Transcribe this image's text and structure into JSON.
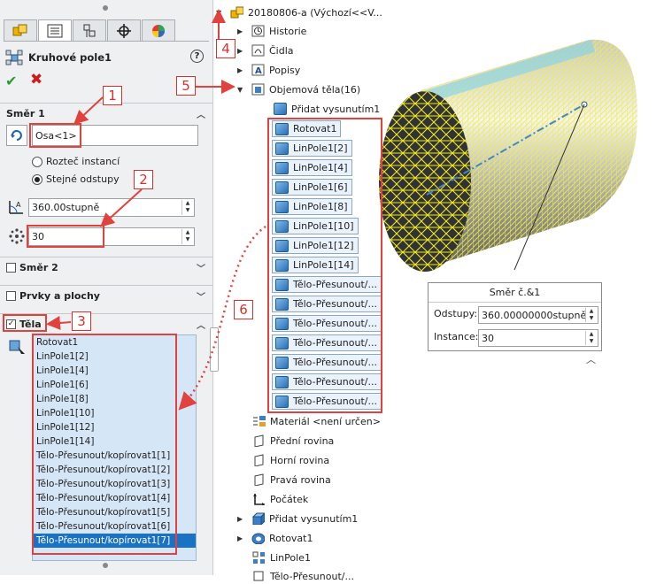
{
  "pm": {
    "title": "Kruhové pole1",
    "help": "?",
    "dir1": {
      "header": "Směr 1",
      "axis_value": "Osa<1>",
      "radio_spacing": "Rozteč instancí",
      "radio_equal": "Stejné odstupy",
      "angle_value": "360.00stupně",
      "count_value": "30"
    },
    "dir2_label": "Směr 2",
    "features_label": "Prvky a plochy",
    "bodies_label": "Těla",
    "bodies": [
      "Rotovat1",
      "LinPole1[2]",
      "LinPole1[4]",
      "LinPole1[6]",
      "LinPole1[8]",
      "LinPole1[10]",
      "LinPole1[12]",
      "LinPole1[14]",
      "Tělo-Přesunout/kopírovat1[1]",
      "Tělo-Přesunout/kopírovat1[2]",
      "Tělo-Přesunout/kopírovat1[3]",
      "Tělo-Přesunout/kopírovat1[4]",
      "Tělo-Přesunout/kopírovat1[5]",
      "Tělo-Přesunout/kopírovat1[6]",
      "Tělo-Přesunout/kopírovat1[7]"
    ]
  },
  "tree": {
    "root": "20180806-a  (Výchozí<<V...",
    "history": "Historie",
    "sensors": "Čidla",
    "annotations": "Popisy",
    "solid_bodies": "Objemová těla(16)",
    "bodies": [
      "Přidat vysunutím1",
      "Rotovat1",
      "LinPole1[2]",
      "LinPole1[4]",
      "LinPole1[6]",
      "LinPole1[8]",
      "LinPole1[10]",
      "LinPole1[12]",
      "LinPole1[14]",
      "Tělo-Přesunout/...",
      "Tělo-Přesunout/...",
      "Tělo-Přesunout/...",
      "Tělo-Přesunout/...",
      "Tělo-Přesunout/...",
      "Tělo-Přesunout/...",
      "Tělo-Přesunout/..."
    ],
    "material": "Materiál <není určen>",
    "front_plane": "Přední rovina",
    "top_plane": "Horní rovina",
    "right_plane": "Pravá rovina",
    "origin": "Počátek",
    "extrude": "Přidat vysunutím1",
    "revolve": "Rotovat1",
    "linpattern": "LinPole1",
    "cut_item": "Tělo-Přesunout/..."
  },
  "dialog": {
    "title": "Směr č.&1",
    "spacing_label": "Odstupy:",
    "spacing_value": "360.00000000stupně",
    "instances_label": "Instance:",
    "instances_value": "30"
  },
  "callouts": [
    "1",
    "2",
    "3",
    "4",
    "5",
    "6"
  ],
  "colors": {
    "callout": "#d9302c",
    "selection": "#1a72c5",
    "check": "#2e9a2e",
    "cancel": "#cc1d1d"
  }
}
